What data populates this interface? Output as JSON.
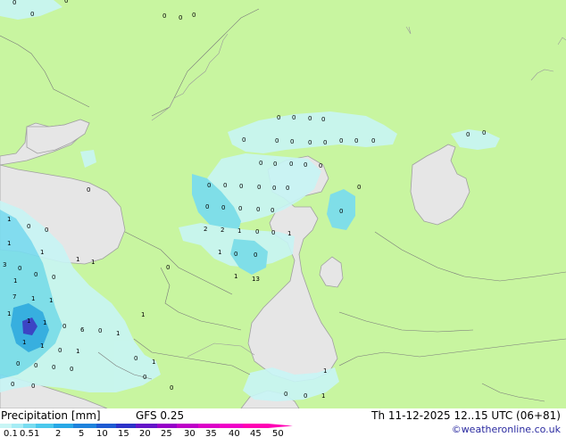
{
  "footer": {
    "title": "Precipitation [mm]",
    "model": "GFS 0.25",
    "datetime": "Th 11-12-2025 12..15 UTC (06+81)",
    "credit": "©weatheronline.co.uk"
  },
  "legend": {
    "levels": [
      "0.1",
      "0.5",
      "1",
      "2",
      "5",
      "10",
      "15",
      "20",
      "25",
      "30",
      "35",
      "40",
      "45",
      "50"
    ],
    "colors": [
      "#c8f5f5",
      "#a6ecf5",
      "#78dcf0",
      "#4bc8ec",
      "#28a8e6",
      "#1e82dc",
      "#1e5ad2",
      "#2d32c8",
      "#6414c8",
      "#9600c8",
      "#be00c8",
      "#dc00c8",
      "#f000c8",
      "#ff00b4"
    ]
  },
  "colors": {
    "land": "#c8f5a0",
    "water": "#e6e6e6",
    "precip_light": "#c8f5f5",
    "precip_medium": "#78dcf0",
    "precip_heavy": "#28a8e6",
    "precip_extreme": "#2d32c8"
  },
  "map_values": [
    "0",
    "0",
    "0",
    "0",
    "0",
    "0",
    "0",
    "0",
    "0",
    "0",
    "0",
    "0",
    "0",
    "0",
    "0",
    "0",
    "0",
    "0",
    "0",
    "0",
    "0",
    "0",
    "0",
    "0",
    "0",
    "0",
    "0",
    "0",
    "0",
    "0",
    "0",
    "0",
    "0",
    "0",
    "0",
    "0",
    "0",
    "0",
    "0",
    "2",
    "2",
    "1",
    "0",
    "0",
    "1",
    "1",
    "0",
    "0",
    "1",
    "0",
    "0",
    "1",
    "1",
    "1",
    "1",
    "0",
    "3",
    "0",
    "0",
    "0",
    "1",
    "1",
    "13",
    "7",
    "1",
    "1",
    "1",
    "1",
    "1",
    "0",
    "6",
    "0",
    "1",
    "1",
    "1",
    "1",
    "0",
    "1",
    "0",
    "1",
    "0",
    "0",
    "0",
    "0",
    "0",
    "0",
    "0",
    "0",
    "0",
    "0",
    "1",
    "1"
  ]
}
